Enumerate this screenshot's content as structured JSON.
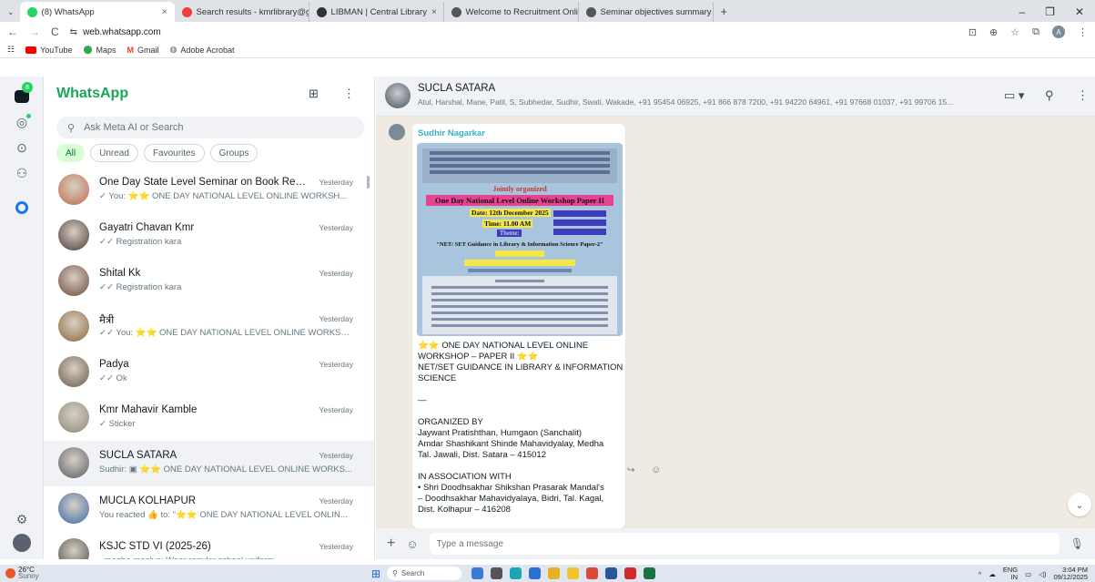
{
  "browser": {
    "tabs": [
      {
        "title": "(8) WhatsApp",
        "color": "#25d366",
        "active": true
      },
      {
        "title": "Search results - kmrlibrary@gm",
        "color": "#ea4335"
      },
      {
        "title": "LIBMAN | Central Library",
        "color": "#333333"
      },
      {
        "title": "Welcome to Recruitment Onlin",
        "color": "#555555"
      },
      {
        "title": "Seminar objectives summary",
        "color": "#555555"
      }
    ],
    "new_tab": "+",
    "url": "web.whatsapp.com",
    "bookmarks": [
      "YouTube",
      "Maps",
      "Gmail",
      "Adobe Acrobat"
    ],
    "profile_initial": "A"
  },
  "sidebar": {
    "title": "WhatsApp",
    "chats_badge": "8",
    "search_placeholder": "Ask Meta AI or Search",
    "filters": [
      "All",
      "Unread",
      "Favourites",
      "Groups"
    ],
    "active_filter": "All",
    "chats": [
      {
        "name": "One Day State Level Seminar on Book Review ...",
        "time": "Yesterday",
        "preview": "✓ You: ⭐⭐ ONE DAY NATIONAL LEVEL ONLINE WORKSH...",
        "color": "#c06a4a"
      },
      {
        "name": "Gayatri Chavan Kmr",
        "time": "Yesterday",
        "preview": "✓✓ Registration kara",
        "color": "#4a3a36"
      },
      {
        "name": "Shital Kk",
        "time": "Yesterday",
        "preview": "✓✓ Registration kara",
        "color": "#6b4a3a"
      },
      {
        "name": "मैत्री",
        "time": "Yesterday",
        "preview": "✓✓ You: ⭐⭐ ONE DAY NATIONAL LEVEL ONLINE WORKSH...",
        "color": "#8a6a3a"
      },
      {
        "name": "Padya",
        "time": "Yesterday",
        "preview": "✓✓ Ok",
        "color": "#6a5a4a"
      },
      {
        "name": "Kmr Mahavir Kamble",
        "time": "Yesterday",
        "preview": "✓ Sticker",
        "color": "#8a8a7a"
      },
      {
        "name": "SUCLA SATARA",
        "time": "Yesterday",
        "preview": "Sudhir: ▣ ⭐⭐ ONE DAY NATIONAL LEVEL ONLINE WORKS...",
        "color": "#5a5e66",
        "selected": true
      },
      {
        "name": "MUCLA KOLHAPUR",
        "time": "Yesterday",
        "preview": "You reacted 👍 to: \"⭐⭐ ONE DAY NATIONAL LEVEL ONLIN...",
        "color": "#3a6aa8"
      },
      {
        "name": "KSJC STD VI (2025-26)",
        "time": "Yesterday",
        "preview": "~megha moolya: Wear regular school uniform",
        "color": "#4a4a4a"
      }
    ]
  },
  "conversation": {
    "group_name": "SUCLA SATARA",
    "members": "Atul, Harshal, Mane, Patil, S, Subhedar, Sudhir, Swati, Wakade, +91 95454 06925, +91 866 878 7200, +91 94220 64961, +91 97668 01037, +91 99706 15...",
    "message": {
      "sender": "Sudhir Nagarkar",
      "poster": {
        "jointly": "Jointly organized",
        "banner": "One Day National Level Online Workshop Paper II",
        "date": "Date: 12th December 2025",
        "time": "Time: 11.00 AM",
        "theme": "Theme:",
        "theme_title": "\"NET/ SET Guidance in Library & Information Science Paper-2\""
      },
      "lines": [
        "⭐⭐ ONE DAY NATIONAL LEVEL ONLINE WORKSHOP – PAPER II ⭐⭐",
        "NET/SET GUIDANCE IN LIBRARY & INFORMATION SCIENCE",
        "",
        "—",
        "",
        "ORGANIZED BY",
        "Jaywant Pratishthan, Humgaon (Sanchalit)",
        "Amdar Shashikant Shinde Mahavidyalay, Medha",
        "Tal. Jawali, Dist. Satara – 415012",
        "",
        "IN ASSOCIATION WITH",
        "• Shri Doodhsakhar Shikshan Prasarak Mandal's",
        "   – Doodhsakhar Mahavidyalaya, Bidri, Tal. Kagal,",
        "   Dist. Kolhapur – 416208"
      ]
    },
    "compose_placeholder": "Type a message"
  },
  "taskbar": {
    "temperature": "26°C",
    "weather": "Sunny",
    "search": "Search",
    "lang": "ENG",
    "region": "IN",
    "time": "3:04 PM",
    "date": "09/12/2025"
  }
}
